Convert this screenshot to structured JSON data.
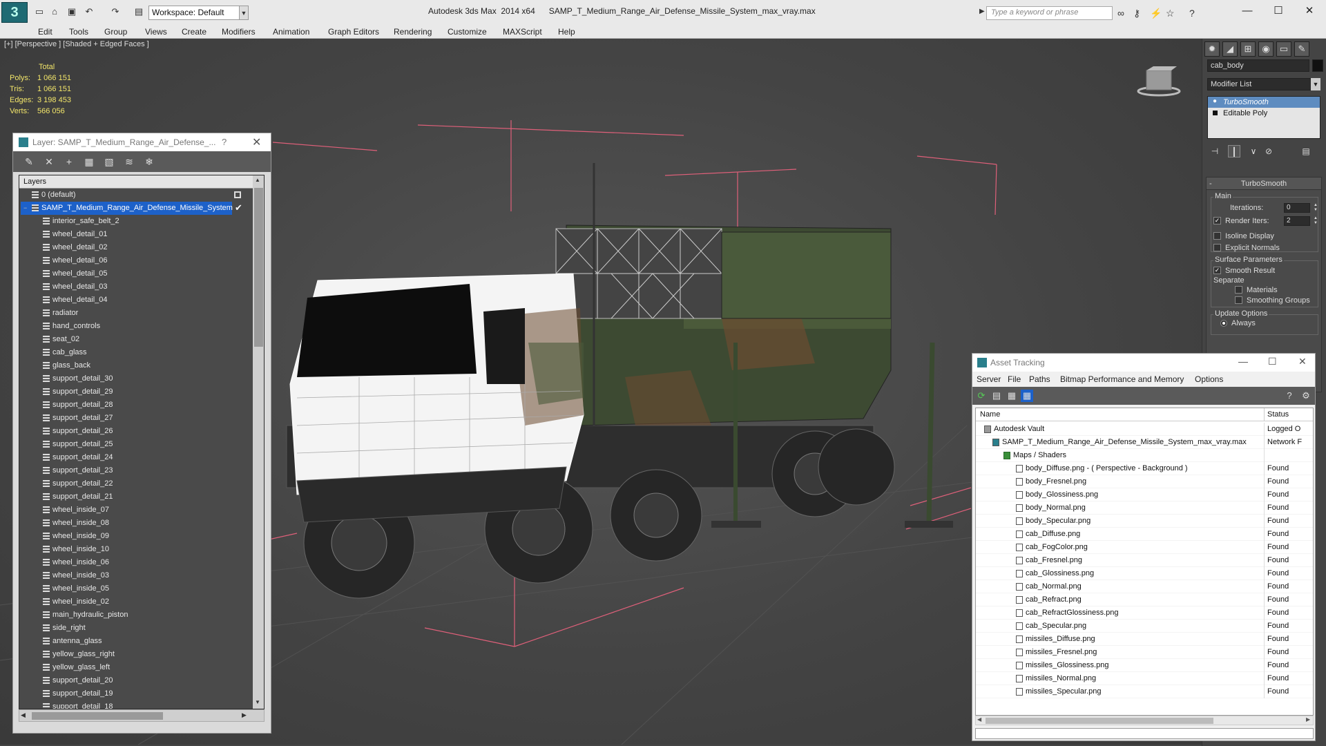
{
  "titlebar": {
    "workspace_label": "Workspace: Default",
    "title": "Autodesk 3ds Max  2014 x64      SAMP_T_Medium_Range_Air_Defense_Missile_System_max_vray.max",
    "search_placeholder": "Type a keyword or phrase"
  },
  "menubar": [
    "Edit",
    "Tools",
    "Group",
    "Views",
    "Create",
    "Modifiers",
    "Animation",
    "Graph Editors",
    "Rendering",
    "Customize",
    "MAXScript",
    "Help"
  ],
  "viewport": {
    "label": "[+] [Perspective ] [Shaded + Edged Faces ]",
    "stats": {
      "header": "Total",
      "rows": [
        {
          "label": "Polys:",
          "value": "1 066 151"
        },
        {
          "label": "Tris:",
          "value": "1 066 151"
        },
        {
          "label": "Edges:",
          "value": "3 198 453"
        },
        {
          "label": "Verts:",
          "value": "566 056"
        }
      ]
    }
  },
  "layer_panel": {
    "title": "Layer: SAMP_T_Medium_Range_Air_Defense_...",
    "help": "?",
    "header": "Layers",
    "default_layer": "0 (default)",
    "selected_layer": "SAMP_T_Medium_Range_Air_Defense_Missile_System",
    "items": [
      "interior_safe_belt_2",
      "wheel_detail_01",
      "wheel_detail_02",
      "wheel_detail_06",
      "wheel_detail_05",
      "wheel_detail_03",
      "wheel_detail_04",
      "radiator",
      "hand_controls",
      "seat_02",
      "cab_glass",
      "glass_back",
      "support_detail_30",
      "support_detail_29",
      "support_detail_28",
      "support_detail_27",
      "support_detail_26",
      "support_detail_25",
      "support_detail_24",
      "support_detail_23",
      "support_detail_22",
      "support_detail_21",
      "wheel_inside_07",
      "wheel_inside_08",
      "wheel_inside_09",
      "wheel_inside_10",
      "wheel_inside_06",
      "wheel_inside_03",
      "wheel_inside_05",
      "wheel_inside_02",
      "main_hydraulic_piston",
      "side_right",
      "antenna_glass",
      "yellow_glass_right",
      "yellow_glass_left",
      "support_detail_20",
      "support_detail_19",
      "support_detail_18"
    ]
  },
  "command_panel": {
    "object_name": "cab_body",
    "modifier_list": "Modifier List",
    "stack": [
      "TurboSmooth",
      "Editable Poly"
    ],
    "rollout_title": "TurboSmooth",
    "main_group": "Main",
    "iterations_label": "Iterations:",
    "iterations_value": "0",
    "render_iters_label": "Render Iters:",
    "render_iters_value": "2",
    "isoline_label": "Isoline Display",
    "explicit_normals_label": "Explicit Normals",
    "surface_params_label": "Surface Parameters",
    "smooth_result_label": "Smooth Result",
    "separate_label": "Separate",
    "materials_label": "Materials",
    "smoothing_groups_label": "Smoothing Groups",
    "update_options_label": "Update Options",
    "always_label": "Always"
  },
  "asset_tracking": {
    "title": "Asset Tracking",
    "menu": [
      "Server",
      "File",
      "Paths",
      "Bitmap Performance and Memory",
      "Options"
    ],
    "col_name": "Name",
    "col_status": "Status",
    "rows": [
      {
        "name": "Autodesk Vault",
        "status": "Logged O",
        "indent": 1
      },
      {
        "name": "SAMP_T_Medium_Range_Air_Defense_Missile_System_max_vray.max",
        "status": "Network F",
        "indent": 2
      },
      {
        "name": "Maps / Shaders",
        "status": "",
        "indent": 3
      },
      {
        "name": "body_Diffuse.png -  ( Perspective - Background )",
        "status": "Found",
        "indent": 4
      },
      {
        "name": "body_Fresnel.png",
        "status": "Found",
        "indent": 4
      },
      {
        "name": "body_Glossiness.png",
        "status": "Found",
        "indent": 4
      },
      {
        "name": "body_Normal.png",
        "status": "Found",
        "indent": 4
      },
      {
        "name": "body_Specular.png",
        "status": "Found",
        "indent": 4
      },
      {
        "name": "cab_Diffuse.png",
        "status": "Found",
        "indent": 4
      },
      {
        "name": "cab_FogColor.png",
        "status": "Found",
        "indent": 4
      },
      {
        "name": "cab_Fresnel.png",
        "status": "Found",
        "indent": 4
      },
      {
        "name": "cab_Glossiness.png",
        "status": "Found",
        "indent": 4
      },
      {
        "name": "cab_Normal.png",
        "status": "Found",
        "indent": 4
      },
      {
        "name": "cab_Refract.png",
        "status": "Found",
        "indent": 4
      },
      {
        "name": "cab_RefractGlossiness.png",
        "status": "Found",
        "indent": 4
      },
      {
        "name": "cab_Specular.png",
        "status": "Found",
        "indent": 4
      },
      {
        "name": "missiles_Diffuse.png",
        "status": "Found",
        "indent": 4
      },
      {
        "name": "missiles_Fresnel.png",
        "status": "Found",
        "indent": 4
      },
      {
        "name": "missiles_Glossiness.png",
        "status": "Found",
        "indent": 4
      },
      {
        "name": "missiles_Normal.png",
        "status": "Found",
        "indent": 4
      },
      {
        "name": "missiles_Specular.png",
        "status": "Found",
        "indent": 4
      }
    ]
  },
  "colors": {
    "selection": "#1d61c9",
    "stats_text": "#f3e66a",
    "gizmo_lines": "#e0607a"
  }
}
